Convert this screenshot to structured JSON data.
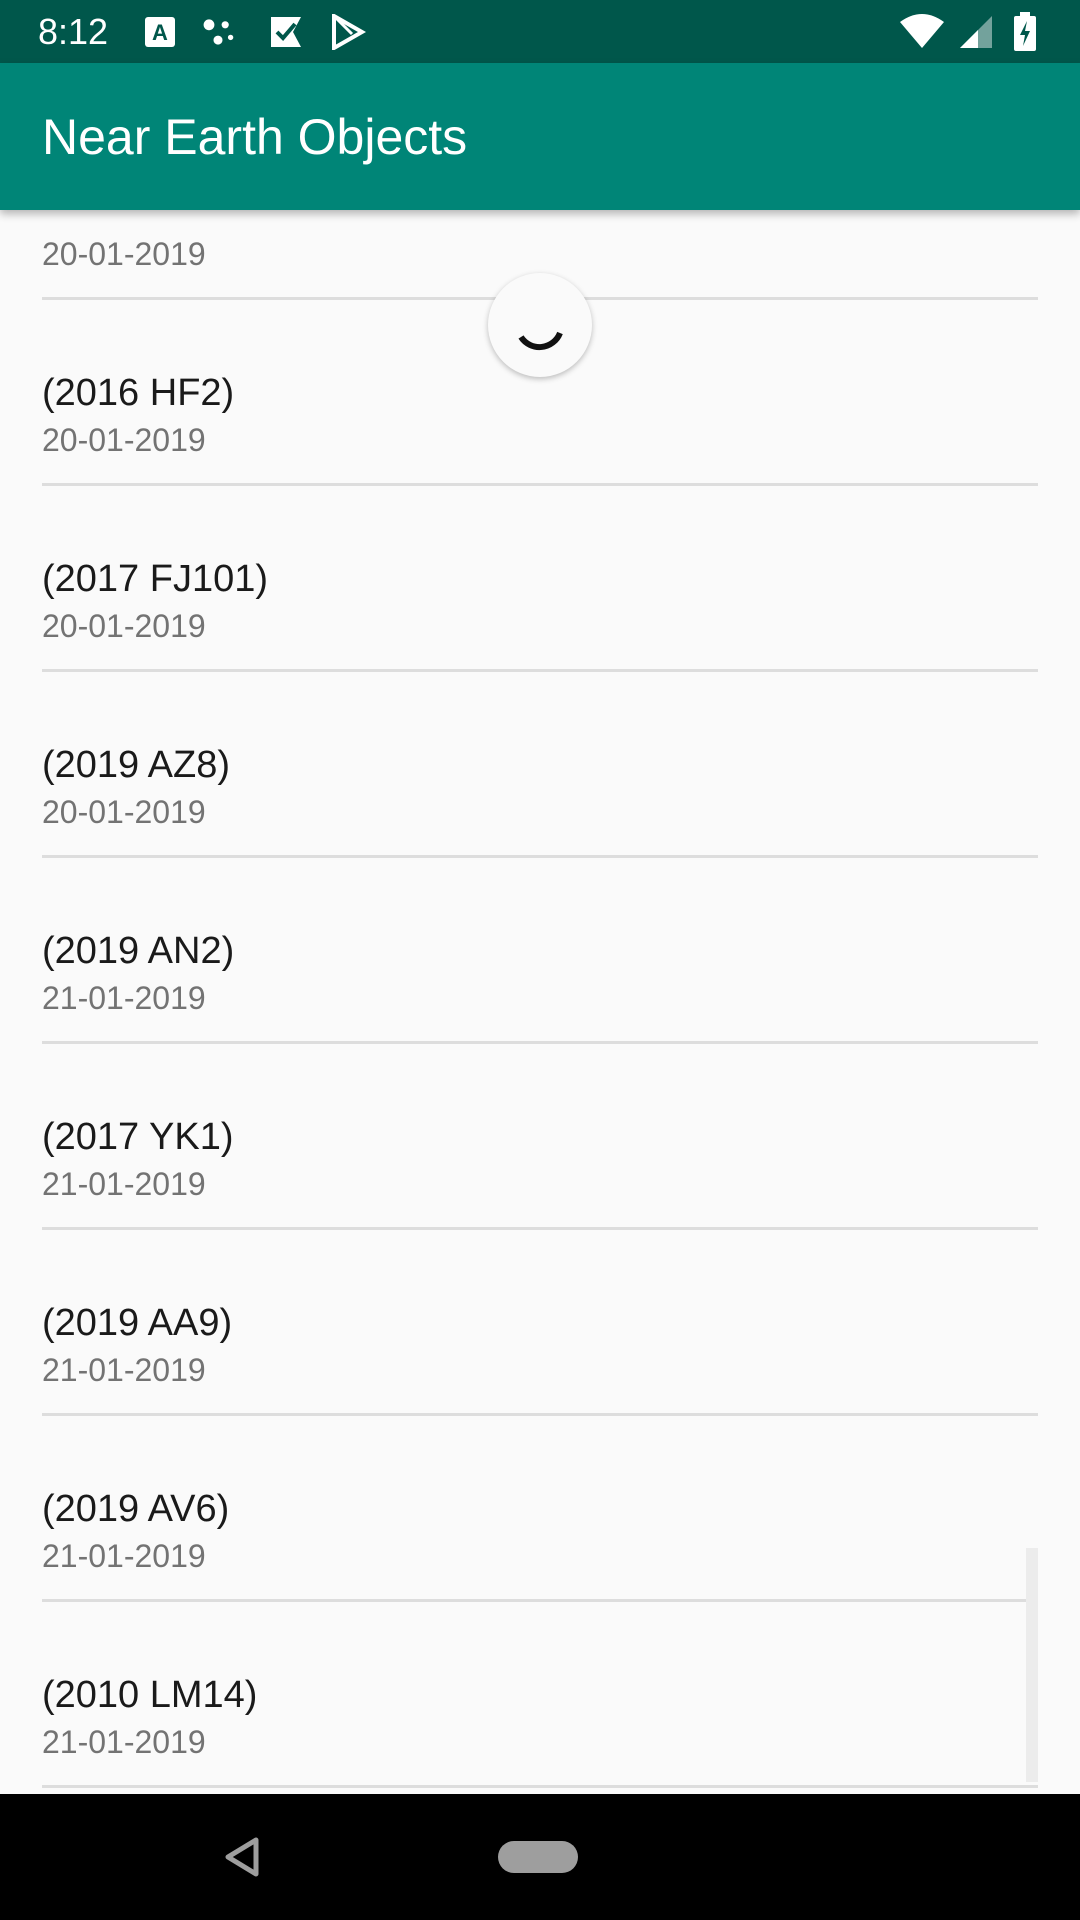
{
  "status_bar": {
    "time": "8:12",
    "icons": [
      "accessibility-a-icon",
      "dots-icon",
      "check-flag-icon",
      "play-store-icon",
      "wifi-icon",
      "signal-icon",
      "battery-charging-icon"
    ]
  },
  "app_bar": {
    "title": "Near Earth Objects"
  },
  "list": {
    "items": [
      {
        "name": "",
        "date": "20-01-2019"
      },
      {
        "name": "(2016 HF2)",
        "date": "20-01-2019"
      },
      {
        "name": "(2017 FJ101)",
        "date": "20-01-2019"
      },
      {
        "name": "(2019 AZ8)",
        "date": "20-01-2019"
      },
      {
        "name": "(2019 AN2)",
        "date": "21-01-2019"
      },
      {
        "name": "(2017 YK1)",
        "date": "21-01-2019"
      },
      {
        "name": "(2019 AA9)",
        "date": "21-01-2019"
      },
      {
        "name": "(2019 AV6)",
        "date": "21-01-2019"
      },
      {
        "name": "(2010 LM14)",
        "date": "21-01-2019"
      }
    ]
  },
  "colors": {
    "status_bar": "#00574b",
    "app_bar": "#008577",
    "background": "#fafafa"
  },
  "nav_bar": {
    "icons": [
      "back-icon",
      "home-pill-icon"
    ]
  }
}
